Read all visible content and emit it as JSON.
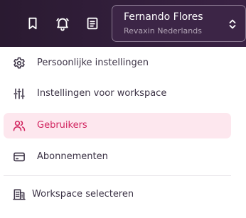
{
  "topbar": {
    "icons": [
      "bookmark-icon",
      "bell-icon",
      "newspaper-icon"
    ],
    "account": {
      "name": "Fernando Flores",
      "organization": "Revaxin Nederlands"
    }
  },
  "menu": {
    "items": [
      {
        "label": "Persoonlijke instellingen",
        "icon": "gear-icon",
        "active": false
      },
      {
        "label": "Instellingen voor workspace",
        "icon": "sliders-icon",
        "active": false
      },
      {
        "label": "Gebruikers",
        "icon": "users-icon",
        "active": true
      },
      {
        "label": "Abonnementen",
        "icon": "credit-card-icon",
        "active": false
      }
    ],
    "footer": {
      "label": "Workspace selecteren",
      "icon": "building-icon"
    }
  },
  "colors": {
    "topbar_bg": "#2a1a31",
    "active_bg": "#fde7ee",
    "active_accent": "#d1245f",
    "text": "#3c3346"
  }
}
